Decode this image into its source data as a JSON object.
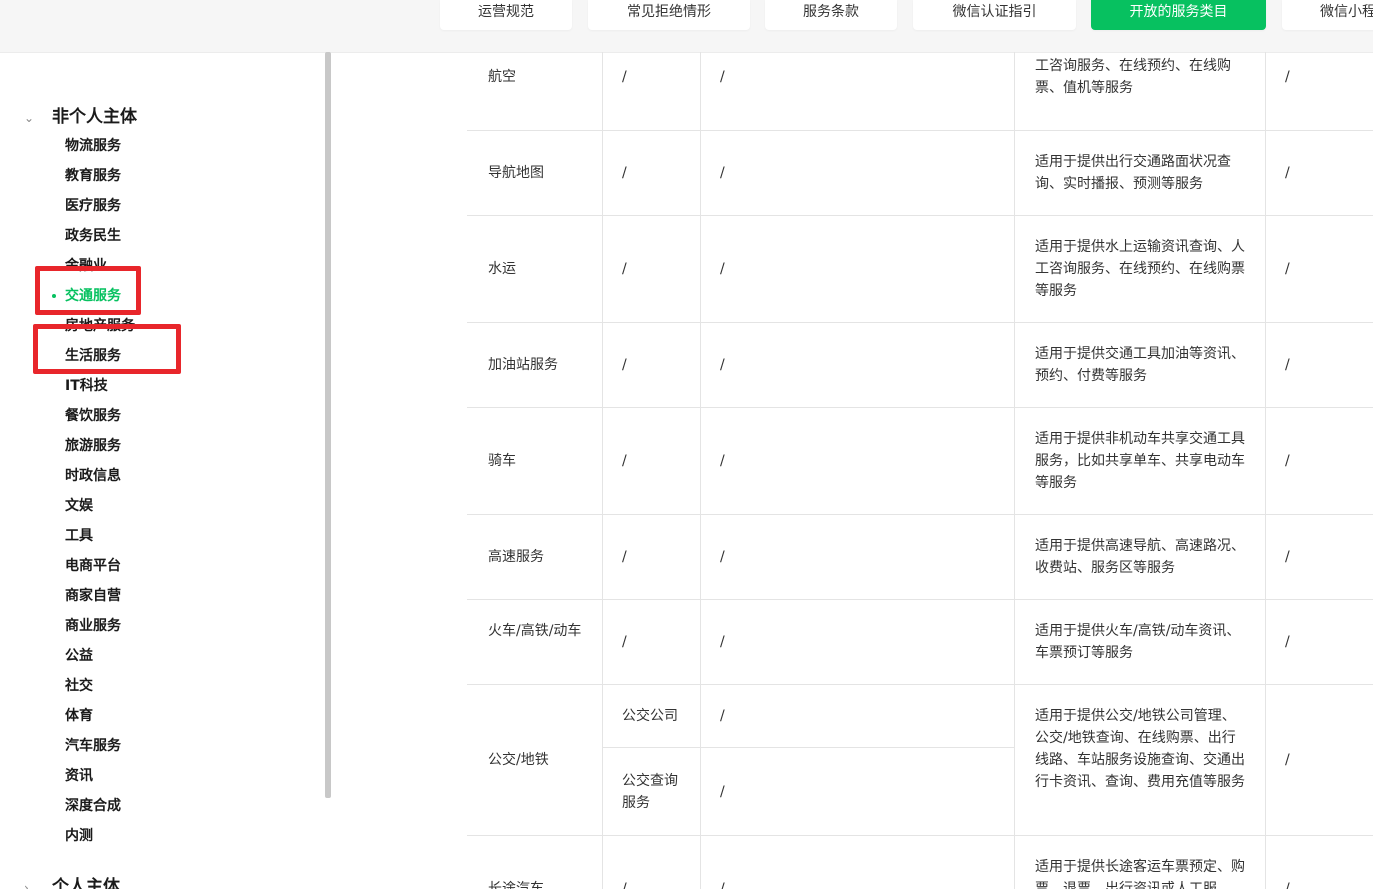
{
  "tabs": [
    "运营规范",
    "常见拒绝情形",
    "服务条款",
    "微信认证指引",
    "开放的服务类目",
    "微信小程"
  ],
  "active_tab_index": 4,
  "sidebar": {
    "group1_title": "非个人主体",
    "group2_title": "个人主体",
    "items": [
      "物流服务",
      "教育服务",
      "医疗服务",
      "政务民生",
      "金融业",
      "交通服务",
      "房地产服务",
      "生活服务",
      "IT科技",
      "餐饮服务",
      "旅游服务",
      "时政信息",
      "文娱",
      "工具",
      "电商平台",
      "商家自营",
      "商业服务",
      "公益",
      "社交",
      "体育",
      "汽车服务",
      "资讯",
      "深度合成",
      "内测"
    ],
    "active_item": "交通服务"
  },
  "colors": {
    "accent": "#07c160",
    "highlight_box": "#e8262b"
  },
  "table": {
    "rows": [
      {
        "name": "航空",
        "c2": "/",
        "c3": "/",
        "desc": "适用于提供航空客运资讯查询、人工咨询服务、在线预约、在线购票、值机等服务",
        "c5": "/"
      },
      {
        "name": "导航地图",
        "c2": "/",
        "c3": "/",
        "desc": "适用于提供出行交通路面状况查询、实时播报、预测等服务",
        "c5": "/"
      },
      {
        "name": "水运",
        "c2": "/",
        "c3": "/",
        "desc": "适用于提供水上运输资讯查询、人工咨询服务、在线预约、在线购票等服务",
        "c5": "/"
      },
      {
        "name": "加油站服务",
        "c2": "/",
        "c3": "/",
        "desc": "适用于提供交通工具加油等资讯、预约、付费等服务",
        "c5": "/"
      },
      {
        "name": "骑车",
        "c2": "/",
        "c3": "/",
        "desc": "适用于提供非机动车共享交通工具服务，比如共享单车、共享电动车等服务",
        "c5": "/"
      },
      {
        "name": "高速服务",
        "c2": "/",
        "c3": "/",
        "desc": "适用于提供高速导航、高速路况、收费站、服务区等服务",
        "c5": "/"
      },
      {
        "name": "火车/高铁/动车",
        "c2": "/",
        "c3": "/",
        "desc": "适用于提供火车/高铁/动车资讯、车票预订等服务",
        "c5": "/"
      },
      {
        "name": "公交/地铁",
        "sub1": "公交公司",
        "sub1_c3": "/",
        "sub2": "公交查询服务",
        "sub2_c3": "/",
        "desc": "适用于提供公交/地铁公司管理、公交/地铁查询、在线购票、出行线路、车站服务设施查询、交通出行卡资讯、查询、费用充值等服务",
        "c5": "/"
      },
      {
        "name": "长途汽车",
        "c2": "/",
        "c3": "/",
        "desc": "适用于提供长途客运车票预定、购票、退票、出行资讯或人工服",
        "c5": "/"
      }
    ]
  }
}
